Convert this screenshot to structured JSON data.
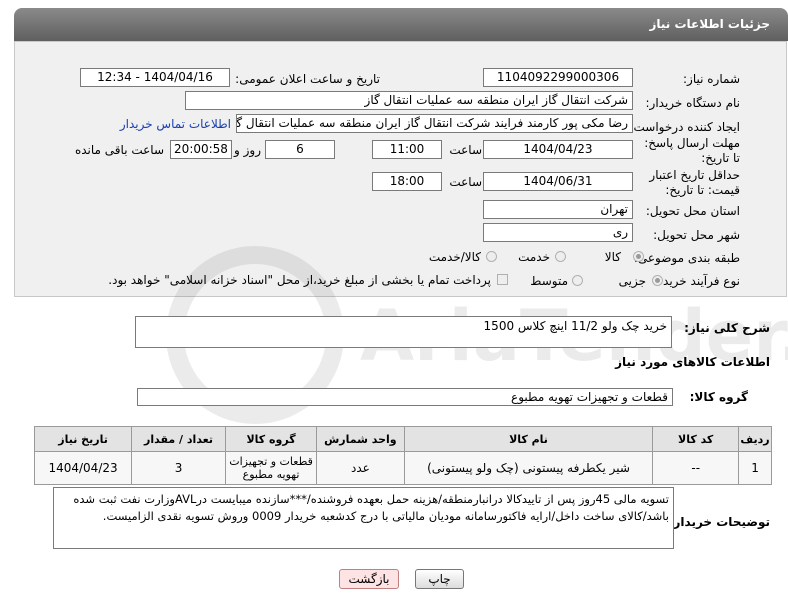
{
  "header": {
    "title": "جزئیات اطلاعات نیاز"
  },
  "fields": {
    "need_number_label": "شماره نیاز:",
    "need_number": "1104092299000306",
    "announce_label": "تاریخ و ساعت اعلان عمومی:",
    "announce_value": "1404/04/16 - 12:34",
    "buyer_org_label": "نام دستگاه خریدار:",
    "buyer_org": "شرکت انتقال گاز ایران منطقه سه عملیات انتقال گاز",
    "requester_label": "ایجاد کننده درخواست:",
    "requester": "رضا مکی پور کارمند فرایند شرکت انتقال گاز ایران منطقه سه عملیات انتقال گاز",
    "contact_link": "اطلاعات تماس خریدار",
    "reply_deadline_label": "مهلت ارسال پاسخ: تا تاریخ:",
    "reply_date": "1404/04/23",
    "hour_label": "ساعت",
    "reply_time": "11:00",
    "days": "6",
    "days_label": "روز و",
    "remaining_time": "20:00:58",
    "remaining_label": "ساعت باقی مانده",
    "price_validity_label": "حداقل تاریخ اعتبار قیمت: تا تاریخ:",
    "price_date": "1404/06/31",
    "price_time": "18:00",
    "province_label": "استان محل تحویل:",
    "province": "تهران",
    "city_label": "شهر محل تحویل:",
    "city": "ری",
    "category_label": "طبقه بندی موضوعی:",
    "category_options": [
      "کالا",
      "خدمت",
      "کالا/خدمت"
    ],
    "process_label": "نوع فرآیند خرید :",
    "process_options": [
      "جزیی",
      "متوسط"
    ],
    "payment_note": "پرداخت تمام یا بخشی از مبلغ خرید،از محل \"اسناد خزانه اسلامی\" خواهد بود."
  },
  "description": {
    "label": "شرح کلی نیاز:",
    "value": "خرید چک ولو 11/2 اینچ کلاس 1500"
  },
  "goods": {
    "section_title": "اطلاعات کالاهای مورد نیاز",
    "group_label": "گروه کالا:",
    "group_value": "قطعات و تجهیزات تهویه مطبوع",
    "columns": [
      "ردیف",
      "کد کالا",
      "نام کالا",
      "واحد شمارش",
      "گروه کالا",
      "تعداد / مقدار",
      "تاریخ نیاز"
    ],
    "rows": [
      [
        "1",
        "--",
        "شیر یکطرفه پیستونی (چک ولو پیستونی)",
        "عدد",
        "قطعات و تجهیزات تهویه مطبوع",
        "3",
        "1404/04/23"
      ]
    ]
  },
  "buyer_notes": {
    "label": "توضیحات خریدار:",
    "value": "تسویه مالی 45روز پس از تاییدکالا درانبارمنطقه/هزینه حمل بعهده فروشنده/***سازنده میبایست درAVLوزارت نفت ثبت شده باشد/کالای ساخت داخل/ارایه فاکتورسامانه مودیان مالیاتی با درج کدشعبه خریدار 0009 وروش تسویه نقدی الزامیست."
  },
  "buttons": {
    "print": "چاپ",
    "back": "بازگشت"
  },
  "watermark": {
    "text": "AriaTender.net"
  }
}
